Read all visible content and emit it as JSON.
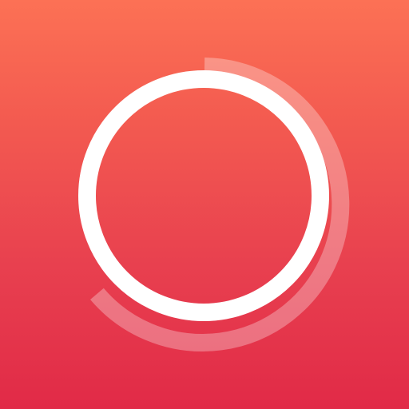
{
  "icon": {
    "name": "timer-ring-icon",
    "progress_arc_fraction": 0.625
  },
  "colors": {
    "background_top": "#FC7155",
    "background_bottom": "#E12A47",
    "main_ring": "#FFFFFF",
    "progress_arc": "#FFFFFF"
  }
}
